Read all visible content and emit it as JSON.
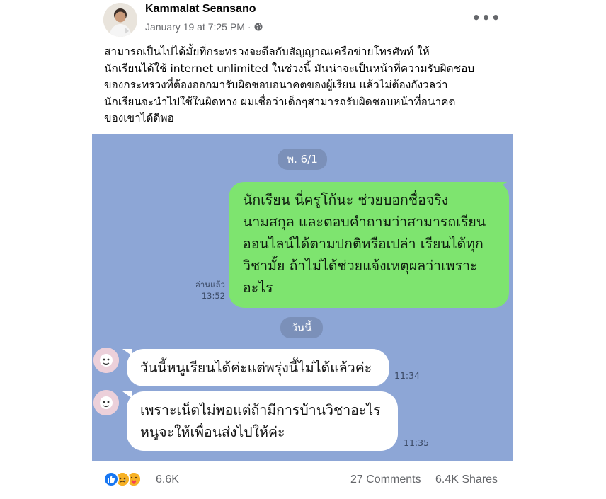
{
  "post": {
    "author": "Kammalat Seansano",
    "timestamp": "January 19 at 7:25 PM",
    "separator": "·",
    "privacy_icon": "globe-icon",
    "more_icon": "more-options-icon",
    "more_label": "•••",
    "caption_lines": [
      "สามารถเป็นไปได้มั้ยที่กระทรวงจะดีลกับสัญญาณเครือข่ายโทรศัพท์ ให้",
      "นักเรียนได้ใช้ internet unlimited ในช่วงนี้ มันน่าจะเป็นหน้าที่ความรับผิดชอบ",
      "ของกระทรวงที่ต้องออกมารับผิดชอบอนาคตของผู้เรียน แล้วไม่ต้องกังวลว่า",
      "นักเรียนจะนำไปใช้ในผิดทาง ผมเชื่อว่าเด็กๆสามารถรับผิดชอบหน้าที่อนาคต",
      "ของเขาได้ดีพอ"
    ]
  },
  "chat": {
    "date_pill_1": "พ. 6/1",
    "outgoing": {
      "lines": [
        "นักเรียน นี่ครูโก้นะ ช่วยบอกชื่อจริง",
        "นามสกุล และตอบคำถามว่าสามารถเรียน",
        "ออนไลน์ได้ตามปกติหรือเปล่า เรียนได้ทุก",
        "วิชามั้ย ถ้าไม่ได้ช่วยแจ้งเหตุผลว่าเพราะ",
        "อะไร"
      ],
      "read_label": "อ่านแล้ว",
      "time": "13:52"
    },
    "date_pill_2": "วันนี้",
    "incoming": [
      {
        "lines": [
          "วันนี้หนูเรียนได้ค่ะแต่พรุ่งนี้ไม่ได้แล้วค่ะ"
        ],
        "time": "11:34"
      },
      {
        "lines": [
          "เพราะเน็ตไม่พอแต่ถ้ามีการบ้านวิชาอะไร",
          "หนูจะให้เพื่อนส่งไปให้ค่ะ"
        ],
        "time": "11:35"
      }
    ],
    "colors": {
      "background": "#8da6d6",
      "outgoing_bubble": "#7ee46f",
      "incoming_bubble": "#ffffff"
    }
  },
  "footer": {
    "reaction_icons": [
      "like-icon",
      "sad-icon",
      "care-icon"
    ],
    "reaction_count": "6.6K",
    "comments": "27 Comments",
    "shares": "6.4K Shares"
  }
}
